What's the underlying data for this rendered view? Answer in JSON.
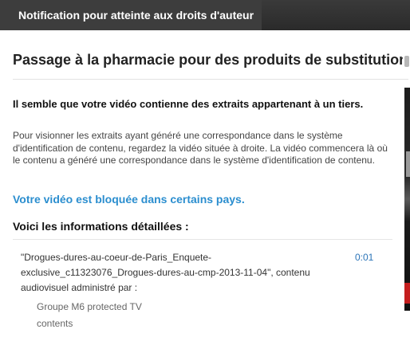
{
  "header": {
    "tab_label": "Notification pour atteinte aux droits d'auteur"
  },
  "main": {
    "title": "Passage à la pharmacie pour des produits de substitution",
    "heading": "Il semble que votre vidéo contienne des extraits appartenant à un tiers.",
    "description": "Pour visionner les extraits ayant généré une correspondance dans le système d'identification de contenu, regardez la vidéo située à droite. La vidéo commencera là où le contenu a généré une correspondance dans le système d'identification de contenu.",
    "blocked_link": "Votre vidéo est bloquée dans certains pays.",
    "details_heading": "Voici les informations détaillées :",
    "match": {
      "text": "\"Drogues-dures-au-coeur-de-Paris_Enquete-exclusive_c11323076_Drogues-dures-au-cmp-2013-11-04\", contenu audiovisuel administré par :",
      "time": "0:01",
      "owner": "Groupe M6 protected TV contents"
    }
  },
  "colors": {
    "top_bar": "#3d3d3d",
    "link": "#2b8ecf",
    "time_link": "#2b74b8"
  }
}
